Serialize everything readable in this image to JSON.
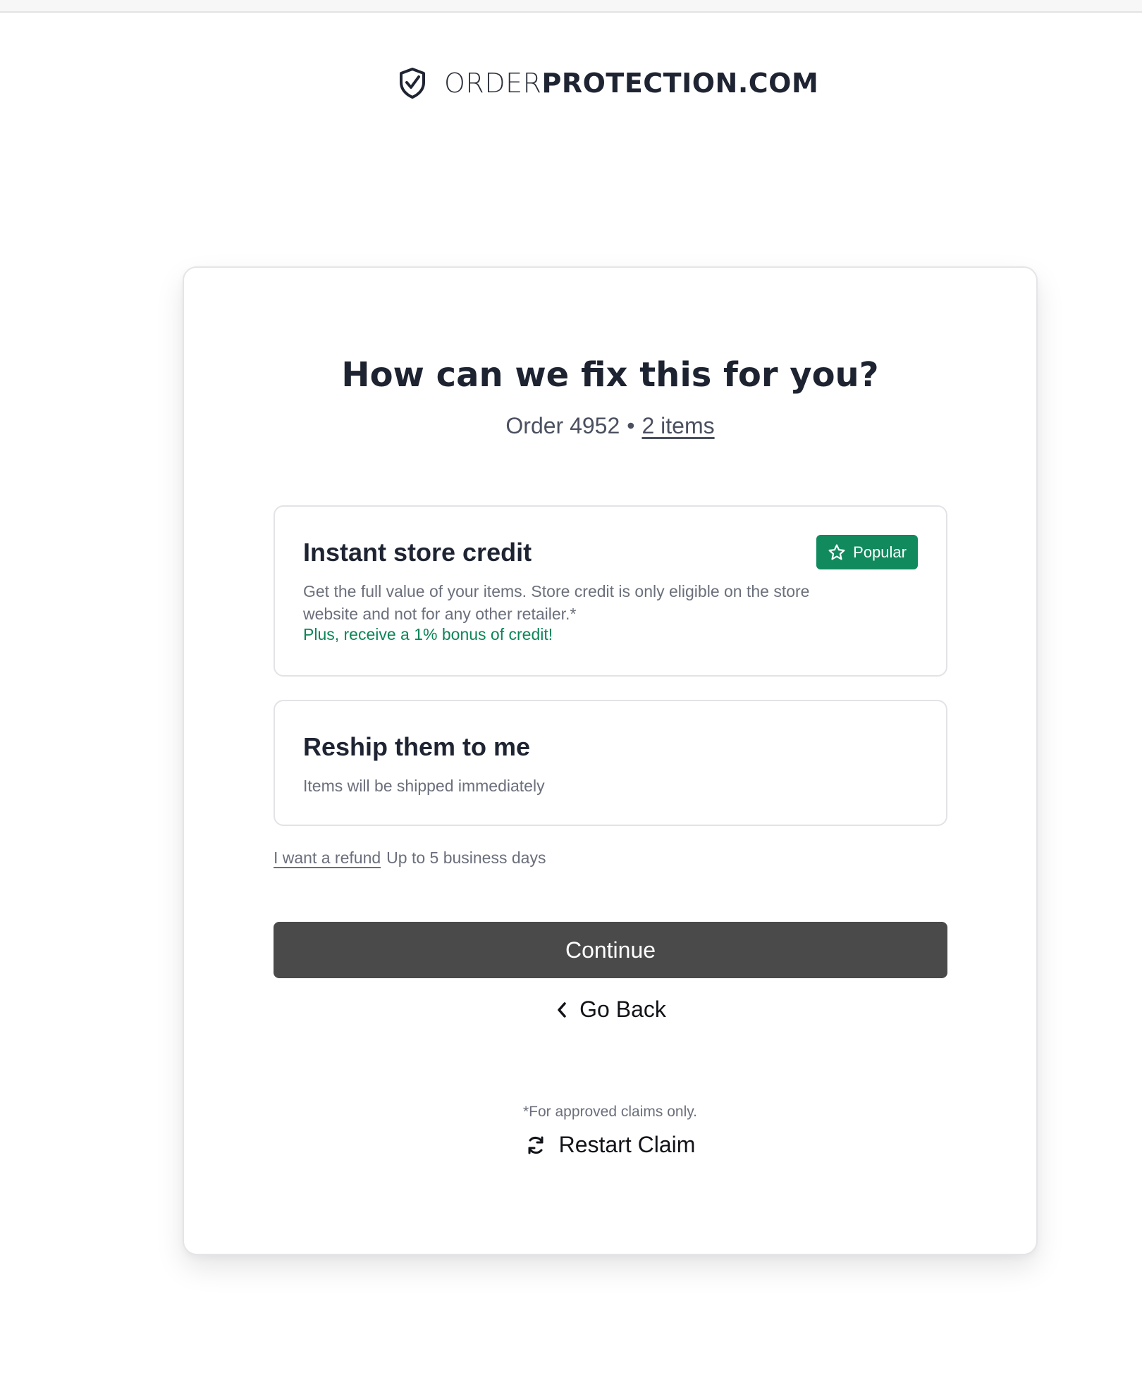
{
  "brand": {
    "name_light": "ORDER",
    "name_bold": "PROTECTION.COM",
    "icon": "shield-check-icon"
  },
  "page": {
    "title": "How can we fix this for you?",
    "order_label": "Order 4952",
    "separator": "•",
    "items_link": "2 items"
  },
  "options": {
    "credit": {
      "title": "Instant store credit",
      "description": "Get the full value of your items. Store credit is only eligible on the store website and not for any other retailer.*",
      "bonus": "Plus, receive a 1% bonus of credit!",
      "badge_label": "Popular",
      "badge_icon": "star-icon"
    },
    "reship": {
      "title": "Reship them to me",
      "description": "Items will be shipped immediately"
    }
  },
  "refund": {
    "link_label": "I want a refund",
    "timing": "Up to 5 business days"
  },
  "actions": {
    "continue_label": "Continue",
    "go_back_label": "Go Back",
    "go_back_icon": "chevron-left-icon",
    "footnote": "*For approved claims only.",
    "restart_label": "Restart Claim",
    "restart_icon": "refresh-icon"
  },
  "colors": {
    "accent_green": "#118a5e",
    "bonus_green": "#0c8557",
    "continue_bg": "#4a4a4b",
    "text_dark": "#1f2433",
    "text_muted": "#6b6f7b"
  }
}
